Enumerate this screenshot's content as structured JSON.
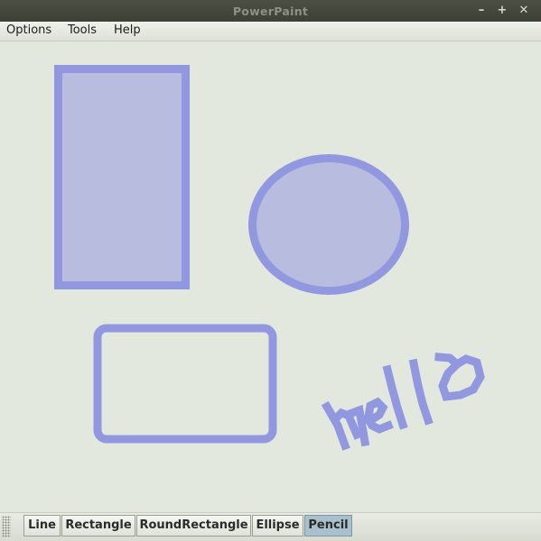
{
  "window": {
    "title": "PowerPaint",
    "controls": {
      "minimize": "–",
      "maximize": "+",
      "close": "✕"
    }
  },
  "menubar": {
    "items": [
      "Options",
      "Tools",
      "Help"
    ]
  },
  "canvas": {
    "stroke_color": "#9198e0",
    "fill_color": "#b8bde0",
    "shapes": [
      "rectangle",
      "ellipse",
      "round-rectangle",
      "pencil"
    ],
    "pencil_text": "hello"
  },
  "toolbar": {
    "buttons": [
      "Line",
      "Rectangle",
      "RoundRectangle",
      "Ellipse",
      "Pencil"
    ],
    "selected": "Pencil",
    "selected_color": "#a9c0cd"
  }
}
